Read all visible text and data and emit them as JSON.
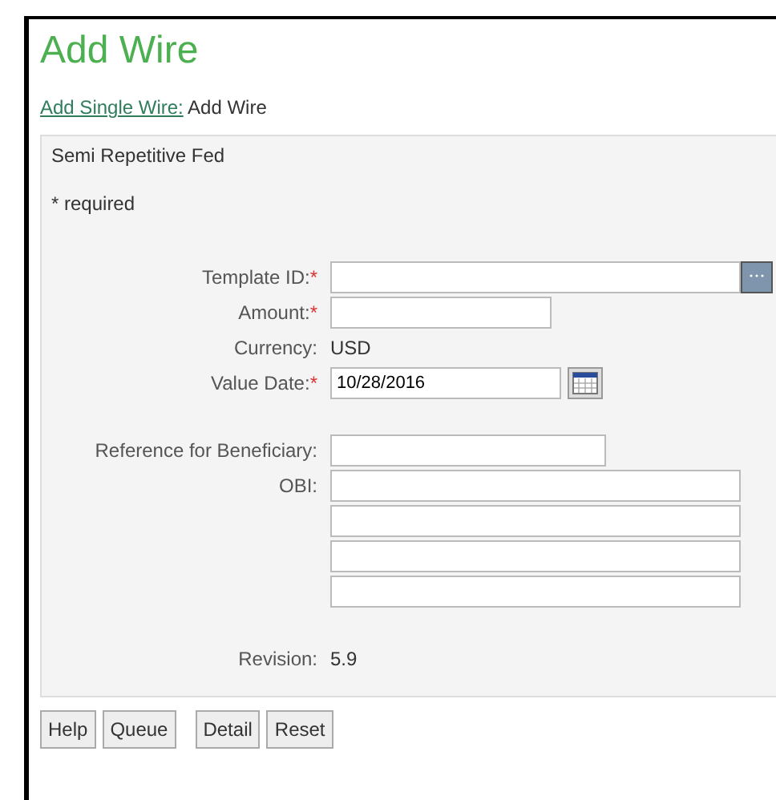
{
  "title": "Add Wire",
  "breadcrumb": {
    "link": "Add Single Wire:",
    "current": "Add Wire"
  },
  "panel": {
    "heading": "Semi Repetitive Fed",
    "required_note": "* required",
    "groups": [
      [
        {
          "label": "Template ID:",
          "required_mark": "*",
          "kind": "lookup"
        },
        {
          "label": "Amount:",
          "required_mark": "*",
          "kind": "amount"
        },
        {
          "label": "Currency:",
          "kind": "text",
          "value": "USD"
        },
        {
          "label": "Value Date:",
          "required_mark": "*",
          "kind": "date",
          "value": "10/28/2016"
        }
      ],
      [
        {
          "label": "Reference for Beneficiary:",
          "kind": "reference"
        },
        {
          "label": "OBI:",
          "kind": "wide"
        },
        {
          "kind": "wide"
        },
        {
          "kind": "wide"
        },
        {
          "kind": "wide"
        }
      ],
      [
        {
          "label": "Revision:",
          "kind": "text",
          "value": "5.9"
        }
      ]
    ]
  },
  "buttons": [
    [
      "Help",
      "Queue"
    ],
    [
      "Detail",
      "Reset"
    ]
  ]
}
